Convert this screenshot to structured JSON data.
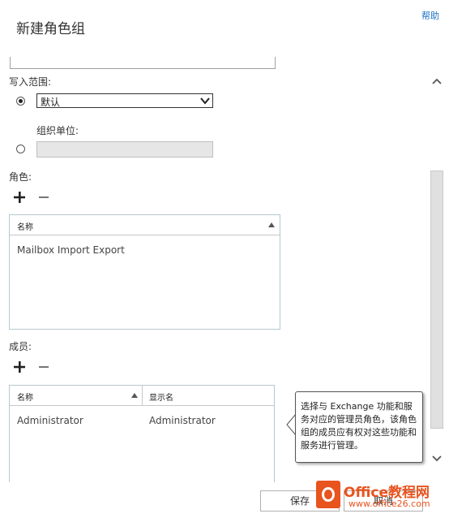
{
  "dialog": {
    "title": "新建角色组",
    "help_link": "帮助"
  },
  "scope": {
    "label": "写入范围:",
    "default_select_value": "默认",
    "ou_label": "组织单位:",
    "ou_value": ""
  },
  "roles": {
    "label": "角色:",
    "columns": [
      "名称"
    ],
    "rows": [
      "Mailbox Import Export"
    ]
  },
  "members": {
    "label": "成员:",
    "columns": [
      "名称",
      "显示名"
    ],
    "rows": [
      {
        "name": "Administrator",
        "display_name": "Administrator"
      }
    ]
  },
  "tooltip": {
    "text": "选择与 Exchange 功能和服务对应的管理员角色，该角色组的成员应有权对这些功能和服务进行管理。"
  },
  "footer": {
    "save_label": "保存",
    "cancel_label": "取消"
  },
  "watermark": {
    "line1": "Office教程网",
    "line2": "www.office26.com"
  },
  "colors": {
    "link": "#1a6fc4",
    "watermark_orange": "#e8531e"
  }
}
